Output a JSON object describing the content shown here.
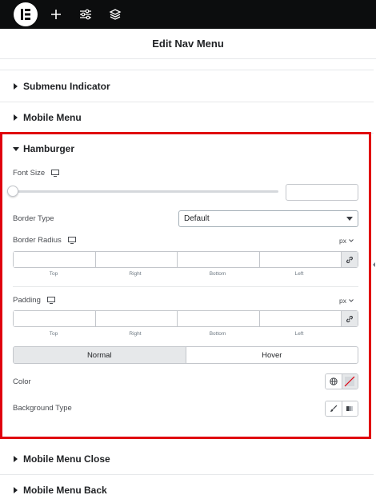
{
  "panel": {
    "title": "Edit Nav Menu"
  },
  "sections": {
    "submenu_indicator": "Submenu Indicator",
    "mobile_menu": "Mobile Menu",
    "hamburger": "Hamburger",
    "mobile_menu_close": "Mobile Menu Close",
    "mobile_menu_back": "Mobile Menu Back"
  },
  "hamburger": {
    "font_size": {
      "label": "Font Size",
      "value": "",
      "slider_fraction": 0
    },
    "border_type": {
      "label": "Border Type",
      "selected": "Default"
    },
    "border_radius": {
      "label": "Border Radius",
      "unit": "px"
    },
    "padding": {
      "label": "Padding",
      "unit": "px"
    },
    "dimension_labels": [
      "Top",
      "Right",
      "Bottom",
      "Left"
    ],
    "tabs": {
      "normal": "Normal",
      "hover": "Hover"
    },
    "color": {
      "label": "Color"
    },
    "background_type": {
      "label": "Background Type"
    }
  },
  "icons": {
    "logo": "elementor-logo-icon",
    "add": "plus-icon",
    "settings": "sliders-icon",
    "layers": "layers-icon",
    "device": "desktop-icon",
    "link": "link-icon",
    "globe": "globe-icon",
    "no_color": "no-color-icon",
    "brush": "brush-icon",
    "gradient": "gradient-icon"
  },
  "colors": {
    "highlight": "#e0000f",
    "topbar": "#0c0d0e"
  }
}
